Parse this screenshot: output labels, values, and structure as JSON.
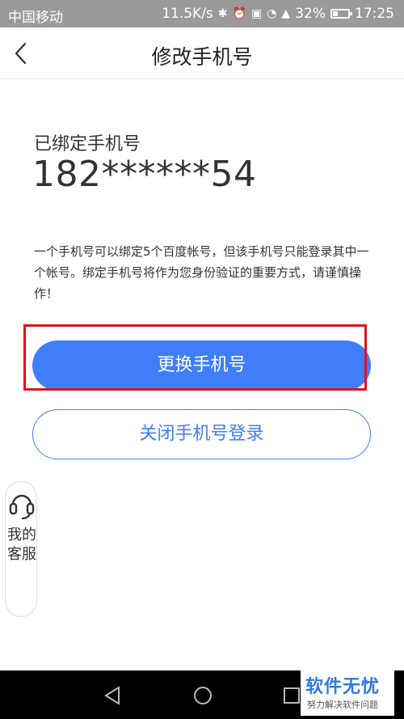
{
  "status_bar": {
    "carrier": "中国移动",
    "speed": "11.5K/s",
    "battery": "32%",
    "time": "17:25"
  },
  "header": {
    "title": "修改手机号"
  },
  "main": {
    "bound_label": "已绑定手机号",
    "phone": "182******54",
    "notice": "一个手机号可以绑定5个百度帐号，但该手机号只能登录其中一个帐号。绑定手机号将作为您身份验证的重要方式，请谨慎操作！",
    "change_button": "更换手机号",
    "close_login_button": "关闭手机号登录"
  },
  "customer_service": {
    "label": "我的客服"
  },
  "watermark": {
    "main": "软件无忧",
    "sub": "努力解决软件问题"
  },
  "colors": {
    "primary": "#3f7ef8",
    "highlight": "#e5101c",
    "status_bar": "#9a9a9a"
  }
}
